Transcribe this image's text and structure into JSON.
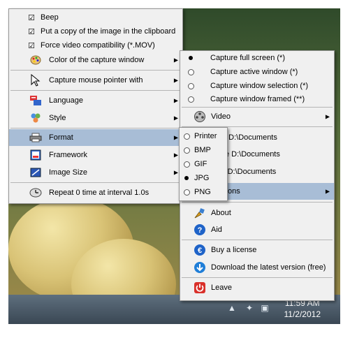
{
  "left_menu": {
    "items": [
      {
        "label": "Beep",
        "icon": "check-icon",
        "checked": true
      },
      {
        "label": "Put a copy of the image in the clipboard",
        "icon": "check-icon",
        "checked": true
      },
      {
        "label": "Force video compatibility (*.MOV)",
        "icon": "check-icon",
        "checked": true
      },
      {
        "label": "Color of the capture window",
        "icon": "palette-icon",
        "submenu": true
      },
      {
        "label": "Capture mouse pointer with",
        "icon": "mouse-pointer-icon",
        "submenu": true
      },
      {
        "label": "Language",
        "icon": "language-icon",
        "submenu": true
      },
      {
        "label": "Style",
        "icon": "style-icon",
        "submenu": true
      },
      {
        "label": "Format",
        "icon": "printer-icon",
        "submenu": true,
        "highlighted": true
      },
      {
        "label": "Framework",
        "icon": "framework-icon",
        "submenu": true
      },
      {
        "label": "Image Size",
        "icon": "image-size-icon",
        "submenu": true
      },
      {
        "label": "Repeat 0 time at interval 1.0s",
        "icon": "clock-icon"
      }
    ]
  },
  "right_menu": {
    "items": [
      {
        "label": "Capture full screen (*)",
        "radio": true,
        "selected": true
      },
      {
        "label": "Capture active window (*)",
        "radio": true
      },
      {
        "label": "Capture window selection (*)",
        "radio": true
      },
      {
        "label": "Capture window framed (**)",
        "radio": true
      },
      {
        "label": "Video",
        "icon": "film-reel-icon",
        "submenu": true
      },
      {
        "label": "n D:\\Documents",
        "icon": "folder-icon"
      },
      {
        "label": "e D:\\Documents",
        "icon": "folder-icon"
      },
      {
        "label": "el D:\\Documents",
        "icon": "folder-icon"
      },
      {
        "label": "ons",
        "submenu": true,
        "highlighted": true
      },
      {
        "label": "About",
        "icon": "about-icon"
      },
      {
        "label": "Aid",
        "icon": "help-icon"
      },
      {
        "label": "Buy a license",
        "icon": "euro-icon"
      },
      {
        "label": "Download the latest version (free)",
        "icon": "download-icon"
      },
      {
        "label": "Leave",
        "icon": "power-icon"
      }
    ]
  },
  "format_menu": {
    "items": [
      {
        "label": "Printer",
        "selected": false
      },
      {
        "label": "BMP",
        "selected": false
      },
      {
        "label": "GIF",
        "selected": false
      },
      {
        "label": "JPG",
        "selected": true
      },
      {
        "label": "PNG",
        "selected": false
      }
    ]
  },
  "taskbar": {
    "time": "11:59 AM",
    "date": "11/2/2012"
  },
  "colors": {
    "menu_bg": "#f0f0f0",
    "highlight": "#a8bdd6",
    "help_blue": "#1f63c8",
    "power_red": "#d9302a"
  }
}
